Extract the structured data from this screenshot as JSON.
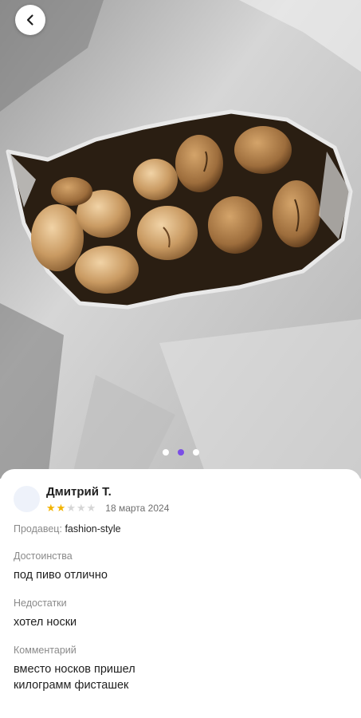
{
  "review": {
    "author_name": "Дмитрий Т.",
    "rating": 2,
    "rating_max": 5,
    "date": "18 марта 2024",
    "seller_label": "Продавец:",
    "seller_name": "fashion-style",
    "pros_label": "Достоинства",
    "pros_text": "под пиво отлично",
    "cons_label": "Недостатки",
    "cons_text": "хотел носки",
    "comment_label": "Комментарий",
    "comment_line1": "вместо носков пришел",
    "comment_line2": "килограмм фисташек"
  },
  "gallery": {
    "current": 2,
    "total": 3
  },
  "colors": {
    "accent": "#7b4ee6",
    "star": "#f2b300"
  },
  "icons": {
    "back": "chevron-left-icon",
    "star": "star-icon"
  }
}
